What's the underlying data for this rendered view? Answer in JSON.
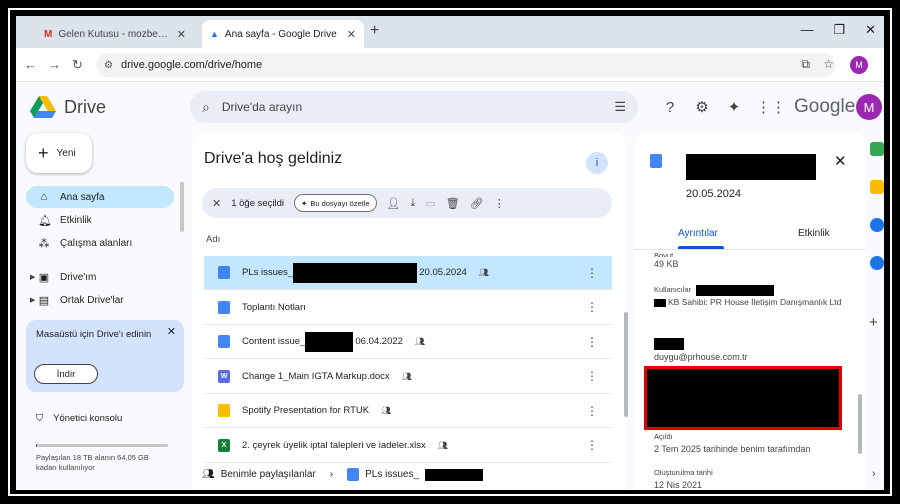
{
  "browser": {
    "tabs": [
      {
        "title": "Gelen Kutusu - mozbek@istanb"
      },
      {
        "title": "Ana sayfa - Google Drive"
      }
    ],
    "url": "drive.google.com/drive/home",
    "profile_initial": "M"
  },
  "header": {
    "app_name": "Drive",
    "search_placeholder": "Drive'da arayın",
    "google_label": "Google",
    "avatar_initial": "M"
  },
  "sidebar": {
    "new_label": "Yeni",
    "items": [
      {
        "label": "Ana sayfa",
        "icon": "home-icon"
      },
      {
        "label": "Etkinlik",
        "icon": "bell-icon"
      },
      {
        "label": "Çalışma alanları",
        "icon": "workspaces-icon"
      },
      {
        "label": "Drive'ım",
        "icon": "my-drive-icon"
      },
      {
        "label": "Ortak Drive'lar",
        "icon": "shared-drives-icon"
      }
    ],
    "promo_text": "Masaüstü için Drive'ı edinin",
    "install_label": "İndir",
    "admin_label": "Yönetici konsolu",
    "storage_text": "Paylaşılan 18 TB alanın 64,05 GB kadarı kullanılıyor",
    "storage_used_fraction": 0.0036
  },
  "main": {
    "title": "Drive'a hoş geldiniz",
    "selection_text": "1 öğe seçildi",
    "summarize_label": "Bu dosyayı özetle",
    "column_name": "Adı",
    "files": [
      {
        "name_pre": "PLs issues_",
        "name_post": "20.05.2024",
        "type": "doc",
        "shared": true,
        "selected": true,
        "redacted": true
      },
      {
        "name_pre": "Toplantı Notları",
        "name_post": "",
        "type": "doc",
        "shared": false,
        "selected": false,
        "redacted": false
      },
      {
        "name_pre": "Content issue_",
        "name_post": "06.04.2022",
        "type": "doc",
        "shared": true,
        "selected": false,
        "redacted": true
      },
      {
        "name_pre": "Change 1_Main IGTA Markup.docx",
        "name_post": "",
        "type": "word",
        "shared": true,
        "selected": false,
        "redacted": false
      },
      {
        "name_pre": "Spotify Presentation for RTUK",
        "name_post": "",
        "type": "slide",
        "shared": true,
        "selected": false,
        "redacted": false
      },
      {
        "name_pre": "2. çeyrek üyelik iptal talepleri ve iadeler.xlsx",
        "name_post": "",
        "type": "sheet",
        "shared": true,
        "selected": false,
        "redacted": false
      }
    ],
    "footer_shared": "Benimle paylaşılanlar",
    "footer_file": "PLs issues_"
  },
  "details": {
    "date": "20.05.2024",
    "tab_details": "Ayrıntılar",
    "tab_activity": "Etkinlik",
    "size_label": "Boyut",
    "size_value": "49 KB",
    "users_label": "Kullanıcılar",
    "owner_text": "KB Sahibi: PR House İletişim Danışmanlık Ltd",
    "email": "duygu@prhouse.com.tr",
    "opened_label": "Açıldı",
    "opened_value": "2 Tem 2025 tarihinde benim tarafımdan",
    "created_label": "Oluşturulma tarihi",
    "created_value": "12 Nis 2021"
  }
}
